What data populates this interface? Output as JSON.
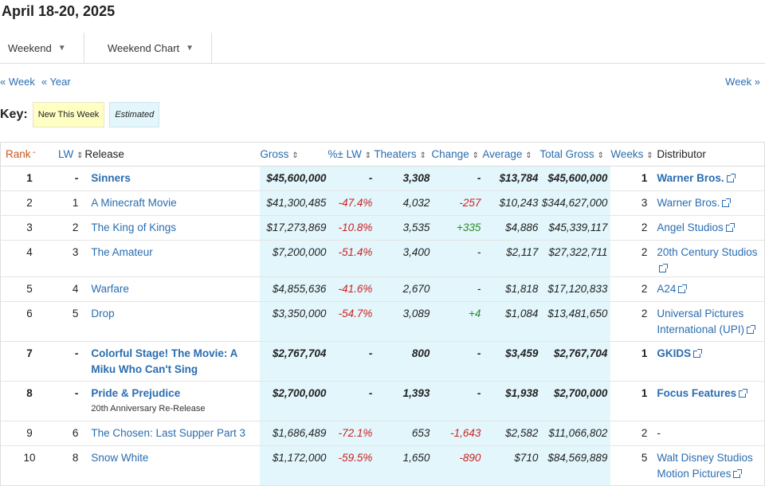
{
  "page": {
    "title": "April 18-20, 2025",
    "tabs": [
      {
        "label": "Weekend"
      },
      {
        "label": "Weekend Chart"
      }
    ],
    "nav": {
      "prev_week": "« Week",
      "prev_year": "« Year",
      "next_week": "Week »"
    },
    "key": {
      "label": "Key:",
      "new": "New This Week",
      "estimated": "Estimated"
    }
  },
  "table": {
    "headers": {
      "rank": "Rank",
      "lw": "LW",
      "release": "Release",
      "gross": "Gross",
      "pct": "%± LW",
      "theaters": "Theaters",
      "change": "Change",
      "average": "Average",
      "total": "Total Gross",
      "weeks": "Weeks",
      "distributor": "Distributor"
    },
    "rows": [
      {
        "rank": "1",
        "lw": "-",
        "release": "Sinners",
        "sub": "",
        "gross": "$45,600,000",
        "pct": "-",
        "theaters": "3,308",
        "change": "-",
        "average": "$13,784",
        "total": "$45,600,000",
        "weeks": "1",
        "distributor": "Warner Bros.",
        "new": true,
        "change_class": "plain",
        "ext": true
      },
      {
        "rank": "2",
        "lw": "1",
        "release": "A Minecraft Movie",
        "sub": "",
        "gross": "$41,300,485",
        "pct": "-47.4%",
        "theaters": "4,032",
        "change": "-257",
        "average": "$10,243",
        "total": "$344,627,000",
        "weeks": "3",
        "distributor": "Warner Bros.",
        "new": false,
        "change_class": "neg",
        "ext": true
      },
      {
        "rank": "3",
        "lw": "2",
        "release": "The King of Kings",
        "sub": "",
        "gross": "$17,273,869",
        "pct": "-10.8%",
        "theaters": "3,535",
        "change": "+335",
        "average": "$4,886",
        "total": "$45,339,117",
        "weeks": "2",
        "distributor": "Angel Studios",
        "new": false,
        "change_class": "pos",
        "ext": true
      },
      {
        "rank": "4",
        "lw": "3",
        "release": "The Amateur",
        "sub": "",
        "gross": "$7,200,000",
        "pct": "-51.4%",
        "theaters": "3,400",
        "change": "-",
        "average": "$2,117",
        "total": "$27,322,711",
        "weeks": "2",
        "distributor": "20th Century Studios",
        "new": false,
        "change_class": "plain",
        "ext": true
      },
      {
        "rank": "5",
        "lw": "4",
        "release": "Warfare",
        "sub": "",
        "gross": "$4,855,636",
        "pct": "-41.6%",
        "theaters": "2,670",
        "change": "-",
        "average": "$1,818",
        "total": "$17,120,833",
        "weeks": "2",
        "distributor": "A24",
        "new": false,
        "change_class": "plain",
        "ext": true
      },
      {
        "rank": "6",
        "lw": "5",
        "release": "Drop",
        "sub": "",
        "gross": "$3,350,000",
        "pct": "-54.7%",
        "theaters": "3,089",
        "change": "+4",
        "average": "$1,084",
        "total": "$13,481,650",
        "weeks": "2",
        "distributor": "Universal Pictures International (UPI)",
        "new": false,
        "change_class": "pos",
        "ext": true
      },
      {
        "rank": "7",
        "lw": "-",
        "release": "Colorful Stage! The Movie: A Miku Who Can't Sing",
        "sub": "",
        "gross": "$2,767,704",
        "pct": "-",
        "theaters": "800",
        "change": "-",
        "average": "$3,459",
        "total": "$2,767,704",
        "weeks": "1",
        "distributor": "GKIDS",
        "new": true,
        "change_class": "plain",
        "ext": true
      },
      {
        "rank": "8",
        "lw": "-",
        "release": "Pride & Prejudice",
        "sub": "20th Anniversary Re-Release",
        "gross": "$2,700,000",
        "pct": "-",
        "theaters": "1,393",
        "change": "-",
        "average": "$1,938",
        "total": "$2,700,000",
        "weeks": "1",
        "distributor": "Focus Features",
        "new": true,
        "change_class": "plain",
        "ext": true
      },
      {
        "rank": "9",
        "lw": "6",
        "release": "The Chosen: Last Supper Part 3",
        "sub": "",
        "gross": "$1,686,489",
        "pct": "-72.1%",
        "theaters": "653",
        "change": "-1,643",
        "average": "$2,582",
        "total": "$11,066,802",
        "weeks": "2",
        "distributor": "-",
        "new": false,
        "change_class": "neg",
        "ext": false
      },
      {
        "rank": "10",
        "lw": "8",
        "release": "Snow White",
        "sub": "",
        "gross": "$1,172,000",
        "pct": "-59.5%",
        "theaters": "1,650",
        "change": "-890",
        "average": "$710",
        "total": "$84,569,889",
        "weeks": "5",
        "distributor": "Walt Disney Studios Motion Pictures",
        "new": false,
        "change_class": "neg",
        "ext": true
      }
    ]
  }
}
